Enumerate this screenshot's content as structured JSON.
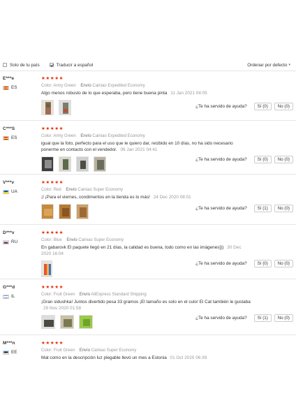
{
  "filters": {
    "own_country": "Solo de tu país",
    "translate": "Traducir a español",
    "sort": "Ordenar por defecto"
  },
  "helpful_question": "¿Te ha servido de ayuda?",
  "colors": {
    "star": "#e62e04",
    "muted": "#999999",
    "border": "#e6e6e6"
  },
  "reviews": [
    {
      "user": "E***e",
      "country": "ES",
      "rating": "★★★★★",
      "color_label": "Color:",
      "color": "Army Green",
      "shipping_label": "Envío",
      "shipping": "Cainiao Expedited Economy",
      "text": "Algo menos robusto de lo que esperaba, pero tiene buena pinta",
      "date": "11 Jan 2021 04:05",
      "yes": "Sí (0)",
      "no": "No (0)"
    },
    {
      "user": "C***S",
      "country": "ES",
      "rating": "★★★★★",
      "color_label": "Color:",
      "color": "Army Green",
      "shipping_label": "Envío",
      "shipping": "Cainiao Expedited Economy",
      "text": "igual que la foto, perfecto para el uso que le quiero dar, recibido en 10 días, no ha sido necesario ponerme en contacto con el vendedor.",
      "date": "06 Jan 2021 04:41",
      "yes": "Sí (0)",
      "no": "No (0)"
    },
    {
      "user": "V***v",
      "country": "UA",
      "rating": "★★★★★",
      "color_label": "Color:",
      "color": "Red",
      "shipping_label": "Envío",
      "shipping": "Cainiao Super Economy",
      "text": "¡! ¡Para el viernes, condimentos en la tienda es lo más!",
      "date": "24 Dec 2020 08:01",
      "yes": "Sí (1)",
      "no": "No (0)"
    },
    {
      "user": "D***v",
      "country": "RU",
      "rating": "★★★★★",
      "color_label": "Color:",
      "color": "Blue",
      "shipping_label": "Envío",
      "shipping": "Cainiao Super Economy",
      "text": "En gabarovk El paquete llegó en 21 días, la calidad es buena, todo como en las imágenes]))",
      "date": "30 Dec 2020 16:04",
      "yes": "Sí (0)",
      "no": "No (0)"
    },
    {
      "user": "G***d",
      "country": "IL",
      "rating": "★★★★★",
      "color_label": "Color:",
      "color": "Fruit Green",
      "shipping_label": "Envío",
      "shipping": "AliExpress Standard Shipping",
      "text": "¡Gran sidushka! Juntos divertido pesa 33 gramos ¡El tamaño es solo en el culo! El Cat también le gustaba",
      "date": "29 Nov 2020 01:58",
      "yes": "Sí (1)",
      "no": "No (0)"
    },
    {
      "user": "M***n",
      "country": "EE",
      "rating": "★★★★★",
      "color_label": "Color:",
      "color": "Fruit Green",
      "shipping_label": "Envío",
      "shipping": "Cainiao Super Economy",
      "text": "Mat como en la descripción luz plegable llevó un mes a Estonia",
      "date": "01 Oct 2020 06:39"
    }
  ]
}
